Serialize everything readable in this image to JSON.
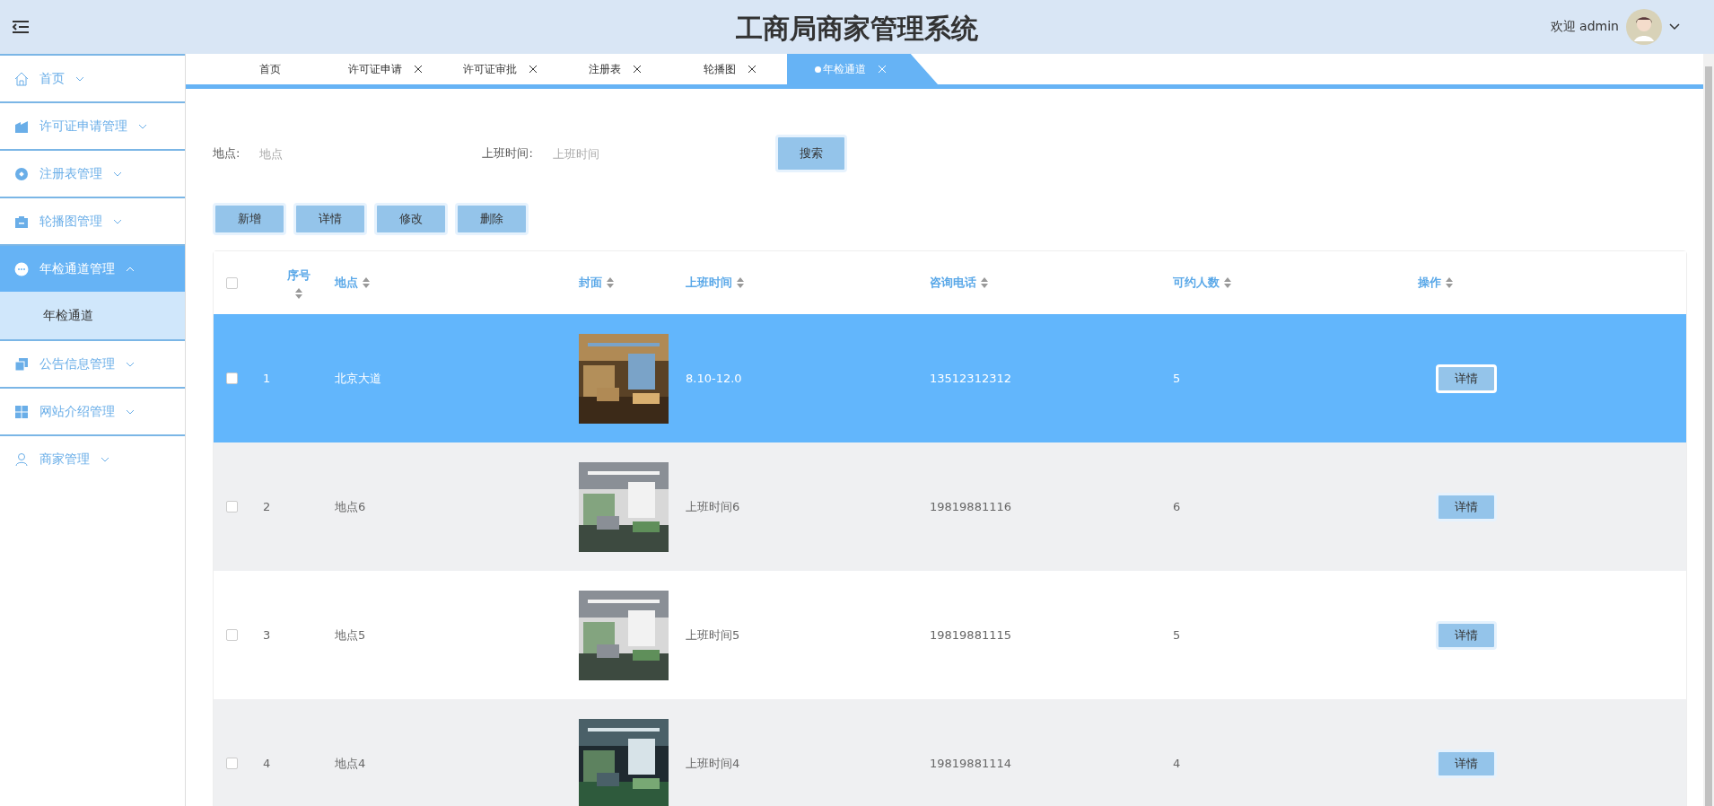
{
  "header": {
    "title": "工商局商家管理系统",
    "welcome": "欢迎 admin"
  },
  "sidebar": {
    "items": [
      {
        "label": "首页",
        "expanded": false,
        "selected": false
      },
      {
        "label": "许可证申请管理",
        "expanded": false,
        "selected": false
      },
      {
        "label": "注册表管理",
        "expanded": false,
        "selected": false
      },
      {
        "label": "轮播图管理",
        "expanded": false,
        "selected": false
      },
      {
        "label": "年检通道管理",
        "expanded": true,
        "selected": true,
        "children": [
          {
            "label": "年检通道",
            "selected": true
          }
        ]
      },
      {
        "label": "公告信息管理",
        "expanded": false,
        "selected": false
      },
      {
        "label": "网站介绍管理",
        "expanded": false,
        "selected": false
      },
      {
        "label": "商家管理",
        "expanded": false,
        "selected": false
      }
    ]
  },
  "tabs": [
    {
      "label": "首页",
      "closable": false,
      "selected": false
    },
    {
      "label": "许可证申请",
      "closable": true,
      "selected": false
    },
    {
      "label": "许可证审批",
      "closable": true,
      "selected": false
    },
    {
      "label": "注册表",
      "closable": true,
      "selected": false
    },
    {
      "label": "轮播图",
      "closable": true,
      "selected": false
    },
    {
      "label": "年检通道",
      "closable": true,
      "selected": true
    }
  ],
  "search": {
    "fields": [
      {
        "label": "地点:",
        "placeholder": "地点"
      },
      {
        "label": "上班时间:",
        "placeholder": "上班时间"
      }
    ],
    "button": "搜索"
  },
  "actions": [
    "新增",
    "详情",
    "修改",
    "删除"
  ],
  "table": {
    "all_checked": false,
    "columns": [
      "序号",
      "地点",
      "封面",
      "上班时间",
      "咨询电话",
      "可约人数",
      "操作"
    ],
    "rows": [
      {
        "no": "1",
        "place": "北京大道",
        "time": "8.10-12.0",
        "phone": "13512312312",
        "count": "5",
        "action": "详情",
        "selected": true,
        "checked": false
      },
      {
        "no": "2",
        "place": "地点6",
        "time": "上班时间6",
        "phone": "19819881116",
        "count": "6",
        "action": "详情",
        "selected": false,
        "checked": false
      },
      {
        "no": "3",
        "place": "地点5",
        "time": "上班时间5",
        "phone": "19819881115",
        "count": "5",
        "action": "详情",
        "selected": false,
        "checked": false
      },
      {
        "no": "4",
        "place": "地点4",
        "time": "上班时间4",
        "phone": "19819881114",
        "count": "4",
        "action": "详情",
        "selected": false,
        "checked": false
      }
    ]
  }
}
